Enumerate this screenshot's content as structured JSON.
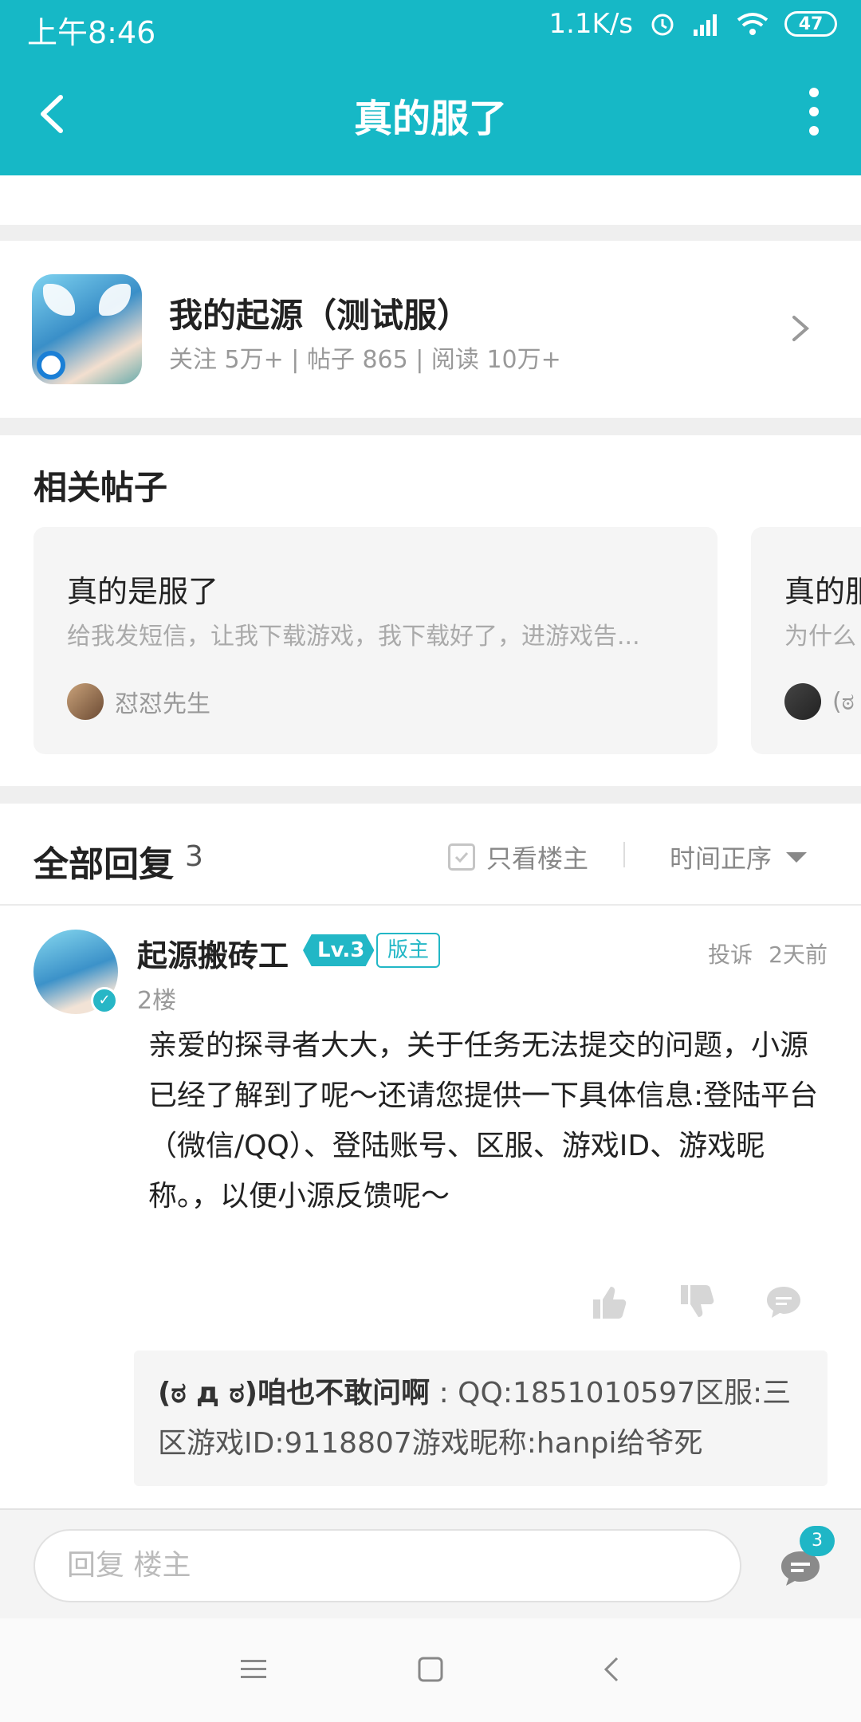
{
  "status_bar": {
    "time": "上午8:46",
    "net_speed": "1.1K/s",
    "battery": "47"
  },
  "header": {
    "title": "真的服了"
  },
  "forum": {
    "name": "我的起源（测试服）",
    "stats": "关注 5万+ | 帖子 865 | 阅读 10万+"
  },
  "related": {
    "heading": "相关帖子",
    "posts": [
      {
        "title": "真的是服了",
        "excerpt": "给我发短信，让我下载游戏，我下载好了，进游戏告...",
        "author": "怼怼先生"
      },
      {
        "title": "真的服",
        "excerpt": "为什么",
        "author": "(ಠ"
      }
    ]
  },
  "replies": {
    "label": "全部回复",
    "count": "3",
    "owner_only": "只看楼主",
    "order": "时间正序"
  },
  "reply": {
    "username": "起源搬砖工",
    "level": "Lv.3",
    "role": "版主",
    "report": "投诉",
    "time": "2天前",
    "floor": "2楼",
    "body": "亲爱的探寻者大大，关于任务无法提交的问题，小源已经了解到了呢～还请您提供一下具体信息:登陆平台（微信/QQ）、登陆账号、区服、游戏ID、游戏昵称。，以便小源反馈呢～",
    "sub_reply": {
      "author": "(ಠ д ಠ)咱也不敢问啊",
      "text": " : QQ:1851010597区服:三区游戏ID:9118807游戏昵称:hanpi给爷死"
    }
  },
  "input": {
    "placeholder": "回复  楼主",
    "comment_count": "3"
  },
  "colors": {
    "accent": "#16b8c6"
  }
}
